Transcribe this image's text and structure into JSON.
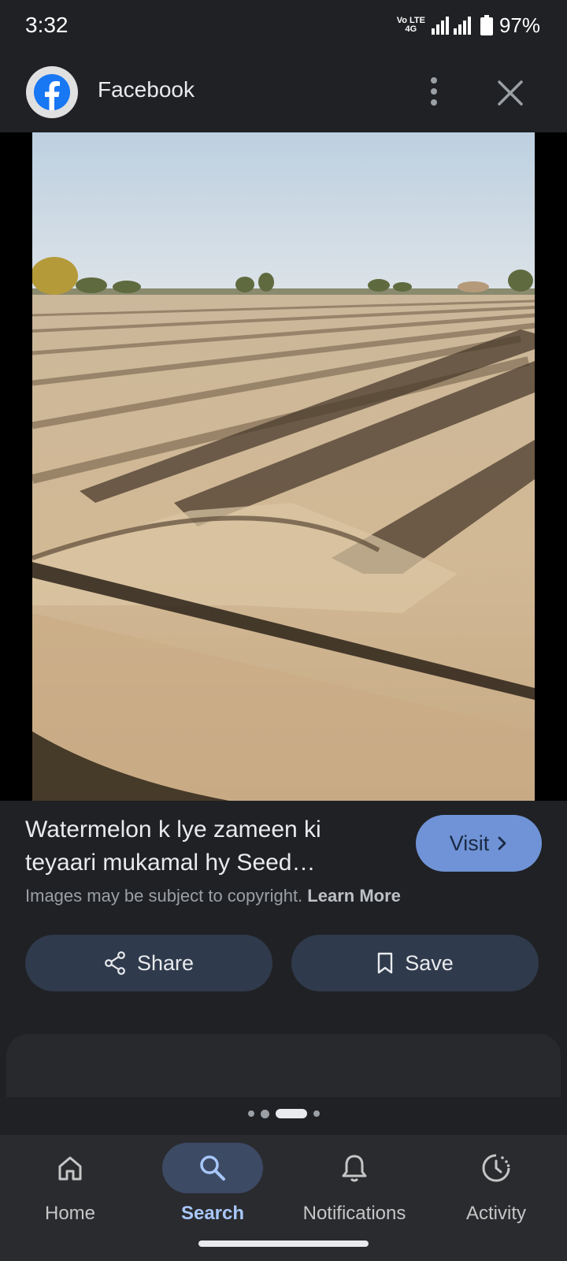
{
  "status": {
    "time": "3:32",
    "network_line1": "Vo LTE",
    "network_line2": "4G",
    "battery": "97%"
  },
  "header": {
    "title": "Facebook",
    "logo_icon": "facebook-logo-icon",
    "more_icon": "more-vert-icon",
    "close_icon": "close-icon"
  },
  "result": {
    "caption": "Watermelon k lye zameen ki teyaari mukamal hy Seed…",
    "visit_label": "Visit",
    "copyright_text": "Images may be subject to copyright.",
    "learn_more": "Learn More"
  },
  "actions": {
    "share_label": "Share",
    "save_label": "Save"
  },
  "pager": {
    "count": 4,
    "active_index": 2
  },
  "nav": {
    "items": [
      {
        "label": "Home",
        "icon": "home-icon"
      },
      {
        "label": "Search",
        "icon": "search-icon",
        "active": true
      },
      {
        "label": "Notifications",
        "icon": "bell-icon"
      },
      {
        "label": "Activity",
        "icon": "activity-icon"
      }
    ]
  },
  "colors": {
    "background": "#202124",
    "accent": "#a8c7fa",
    "visit_button": "#6f93d6",
    "action_button": "#2f3a4c",
    "facebook_blue": "#1877f2"
  }
}
